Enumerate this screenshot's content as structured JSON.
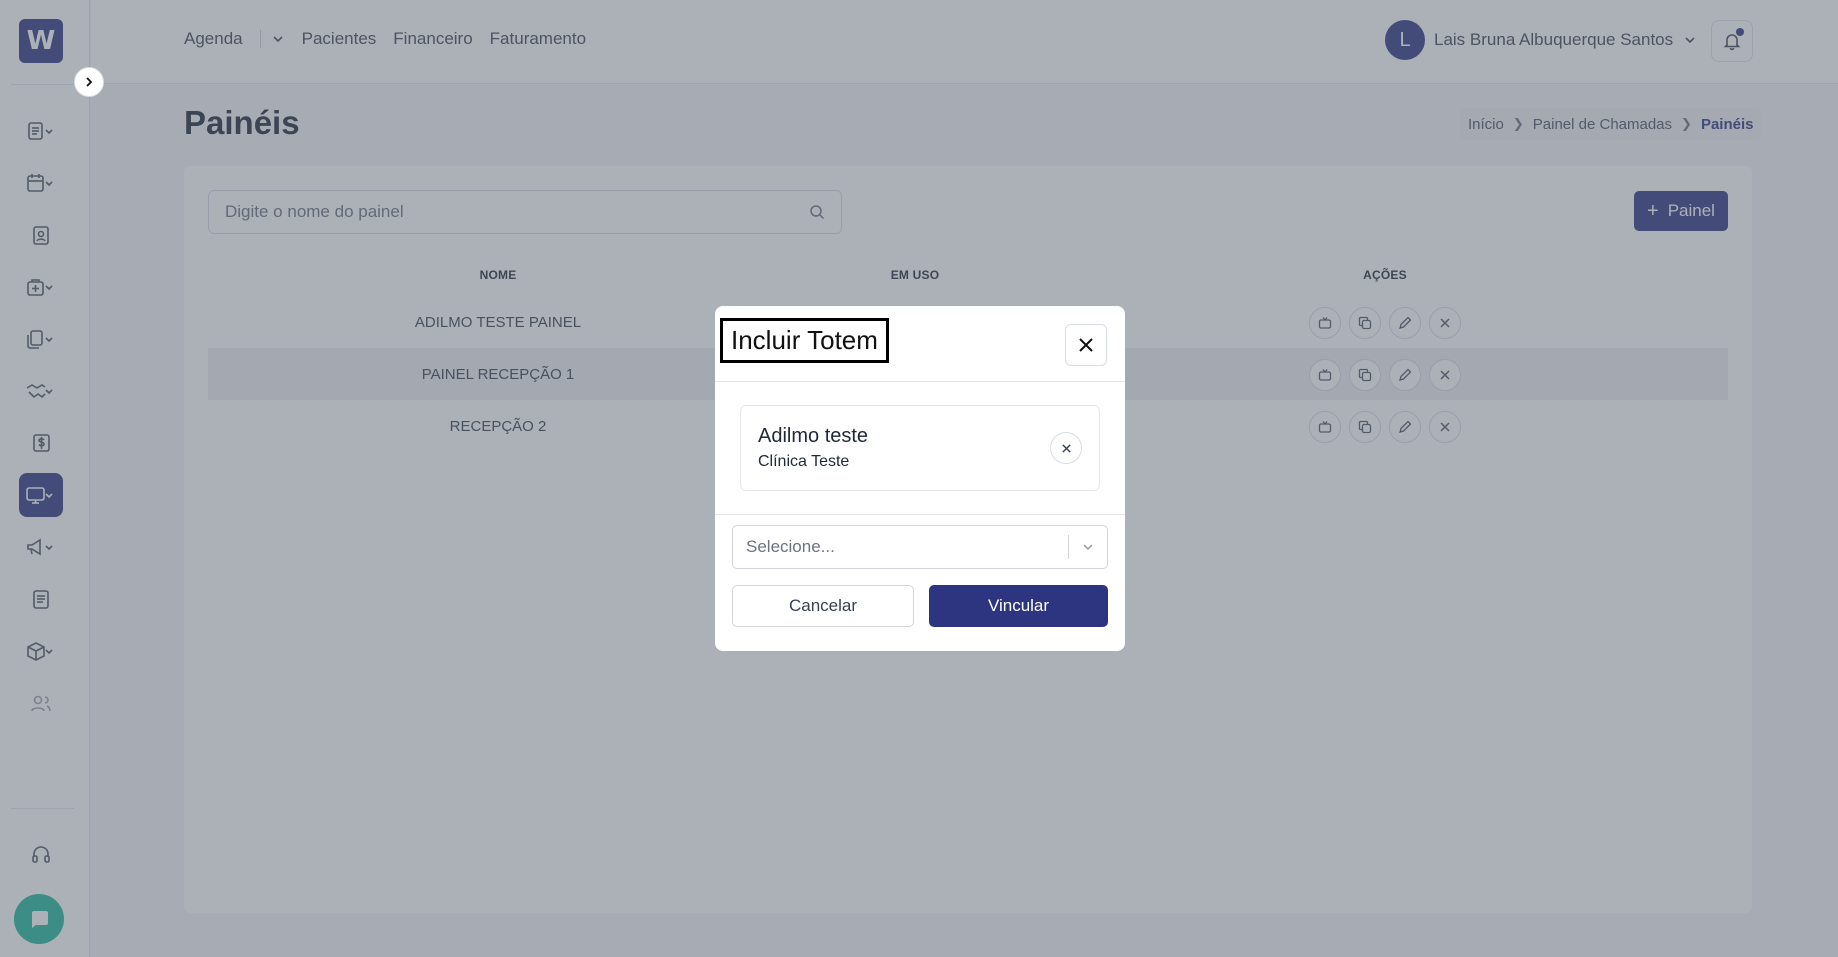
{
  "app": {
    "logo_letter": "W",
    "brand_color": "#2d3580",
    "chat_color": "#1fb89a"
  },
  "topnav": {
    "items": [
      "Agenda",
      "Pacientes",
      "Financeiro",
      "Faturamento"
    ],
    "user_initial": "L",
    "user_name": "Lais Bruna Albuquerque Santos"
  },
  "sidebar": {
    "icons": [
      "records-icon",
      "calendar-icon",
      "patient-card-icon",
      "medical-bag-icon",
      "documents-icon",
      "handshake-icon",
      "dollar-icon",
      "monitor-icon",
      "megaphone-icon",
      "reports-icon",
      "package-icon",
      "users-icon",
      "headset-icon"
    ],
    "active": "monitor-icon"
  },
  "page": {
    "title": "Painéis",
    "breadcrumb": [
      "Início",
      "Painel de Chamadas",
      "Painéis"
    ]
  },
  "panel_list": {
    "search_placeholder": "Digite o nome do painel",
    "add_button_label": "Painel",
    "columns": [
      "NOME",
      "EM USO",
      "AÇÕES"
    ],
    "rows": [
      {
        "name": "ADILMO TESTE PAINEL"
      },
      {
        "name": "PAINEL RECEPÇÃO 1"
      },
      {
        "name": "RECEPÇÃO 2"
      }
    ]
  },
  "modal": {
    "title": "Incluir Totem",
    "totem": {
      "name": "Adilmo teste",
      "clinic": "Clínica Teste"
    },
    "select_placeholder": "Selecione...",
    "cancel_label": "Cancelar",
    "confirm_label": "Vincular"
  }
}
